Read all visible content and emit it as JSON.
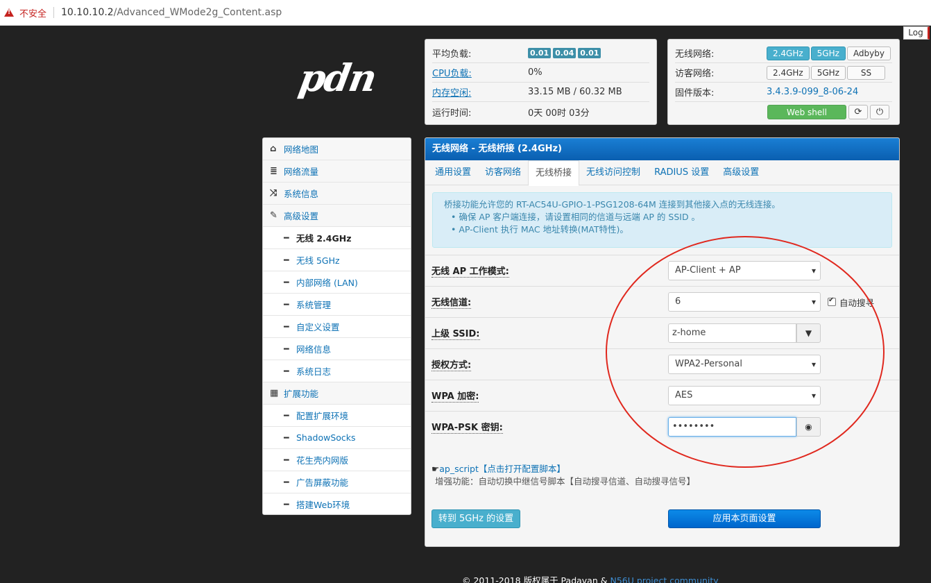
{
  "browser": {
    "warning_text": "不安全",
    "url_host": "10.10.10.2",
    "url_path": "/Advanced_WMode2g_Content.asp"
  },
  "log_button": "Log",
  "logo_text": "pdn",
  "status": {
    "load_label": "平均负载:",
    "load_values": [
      "0.01",
      "0.04",
      "0.01"
    ],
    "cpu_label": "CPU负载:",
    "cpu_value": "0%",
    "mem_label": "内存空闲:",
    "mem_value": "33.15 MB / 60.32 MB",
    "uptime_label": "运行时间:",
    "uptime_value": "0天 00时 03分"
  },
  "network": {
    "wireless_label": "无线网络:",
    "wireless_buttons": [
      "2.4GHz",
      "5GHz",
      "Adbyby"
    ],
    "guest_label": "访客网络:",
    "guest_buttons": [
      "2.4GHz",
      "5GHz",
      "SS"
    ],
    "firmware_label": "固件版本:",
    "firmware_value": "3.4.3.9-099_8-06-24",
    "webshell_label": "Web shell",
    "refresh_icon": "refresh-icon",
    "power_icon": "power-icon"
  },
  "sidebar": {
    "items": [
      {
        "label": "网络地图",
        "icon": "home-icon"
      },
      {
        "label": "网络流量",
        "icon": "list-icon"
      },
      {
        "label": "系统信息",
        "icon": "shuffle-icon"
      },
      {
        "label": "高级设置",
        "icon": "wrench-icon"
      },
      {
        "label": "无线 2.4GHz"
      },
      {
        "label": "无线 5GHz"
      },
      {
        "label": "内部网络 (LAN)"
      },
      {
        "label": "系统管理"
      },
      {
        "label": "自定义设置"
      },
      {
        "label": "网络信息"
      },
      {
        "label": "系统日志"
      },
      {
        "label": "扩展功能",
        "icon": "grid-icon"
      },
      {
        "label": "配置扩展环境"
      },
      {
        "label": "ShadowSocks"
      },
      {
        "label": "花生壳内网版"
      },
      {
        "label": "广告屏蔽功能"
      },
      {
        "label": "搭建Web环境"
      }
    ]
  },
  "main": {
    "title": "无线网络 - 无线桥接 (2.4GHz)",
    "tabs": [
      "通用设置",
      "访客网络",
      "无线桥接",
      "无线访问控制",
      "RADIUS 设置",
      "高级设置"
    ],
    "info": {
      "line1": "桥接功能允许您的 RT-AC54U-GPIO-1-PSG1208-64M 连接到其他接入点的无线连接。",
      "bullet1": "确保 AP 客户端连接，请设置相同的信道与远端 AP 的 SSID 。",
      "bullet2": "AP-Client 执行 MAC 地址转换(MAT特性)。"
    },
    "fields": {
      "mode_label": "无线 AP 工作模式:",
      "mode_value": "AP-Client + AP",
      "channel_label": "无线信道:",
      "channel_value": "6",
      "auto_search_label": "自动搜寻",
      "ssid_label": "上级 SSID:",
      "ssid_value": "z-home",
      "auth_label": "授权方式:",
      "auth_value": "WPA2-Personal",
      "wpa_enc_label": "WPA 加密:",
      "wpa_enc_value": "AES",
      "psk_label": "WPA-PSK 密钥:",
      "psk_value": "••••••••"
    },
    "script_link": "ap_script【点击打开配置脚本】",
    "script_desc": "增强功能：自动切换中继信号脚本【自动搜寻信道、自动搜寻信号】",
    "btn_5g": "转到 5GHz 的设置",
    "btn_apply": "应用本页面设置"
  },
  "footer": {
    "text": "© 2011-2018 版权属于 Padavan & ",
    "link": "N56U project community"
  },
  "colors": {
    "accent": "#0e72b5",
    "header_blue": "#0a5fb0",
    "highlight_circle": "#e0281e"
  }
}
